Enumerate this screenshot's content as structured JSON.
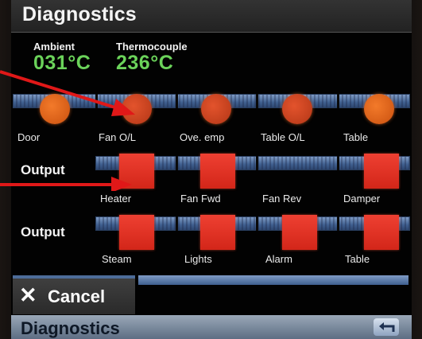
{
  "header": {
    "title": "Diagnostics"
  },
  "readouts": [
    {
      "label": "Ambient",
      "value": "031°C"
    },
    {
      "label": "Thermocouple",
      "value": "236°C"
    }
  ],
  "inputs_row": {
    "items": [
      {
        "label": "Door",
        "state": "on"
      },
      {
        "label": "Fan O/L",
        "state": "on"
      },
      {
        "label": "Ove. emp",
        "state": "on"
      },
      {
        "label": "Table O/L",
        "state": "on"
      },
      {
        "label": "Table",
        "state": "on"
      }
    ]
  },
  "output_row_1": {
    "label": "Output",
    "items": [
      {
        "label": "Heater",
        "state": "on"
      },
      {
        "label": "Fan Fwd",
        "state": "on"
      },
      {
        "label": "Fan Rev",
        "state": "off"
      },
      {
        "label": "Damper",
        "state": "on"
      }
    ]
  },
  "output_row_2": {
    "label": "Output",
    "items": [
      {
        "label": "Steam",
        "state": "on"
      },
      {
        "label": "Lights",
        "state": "on"
      },
      {
        "label": "Alarm",
        "state": "on"
      },
      {
        "label": "Table",
        "state": "on"
      }
    ]
  },
  "cancel_button": {
    "icon": "close-icon",
    "label": "Cancel"
  },
  "footer": {
    "title": "Diagnostics",
    "back_icon": "back-arrow-icon"
  },
  "colors": {
    "readout_value": "#6bd35a",
    "indicator_round": "#e4661f",
    "indicator_square": "#e23a2b",
    "bar_blue": "#5a78a8",
    "annotation_arrow": "#e01818"
  }
}
